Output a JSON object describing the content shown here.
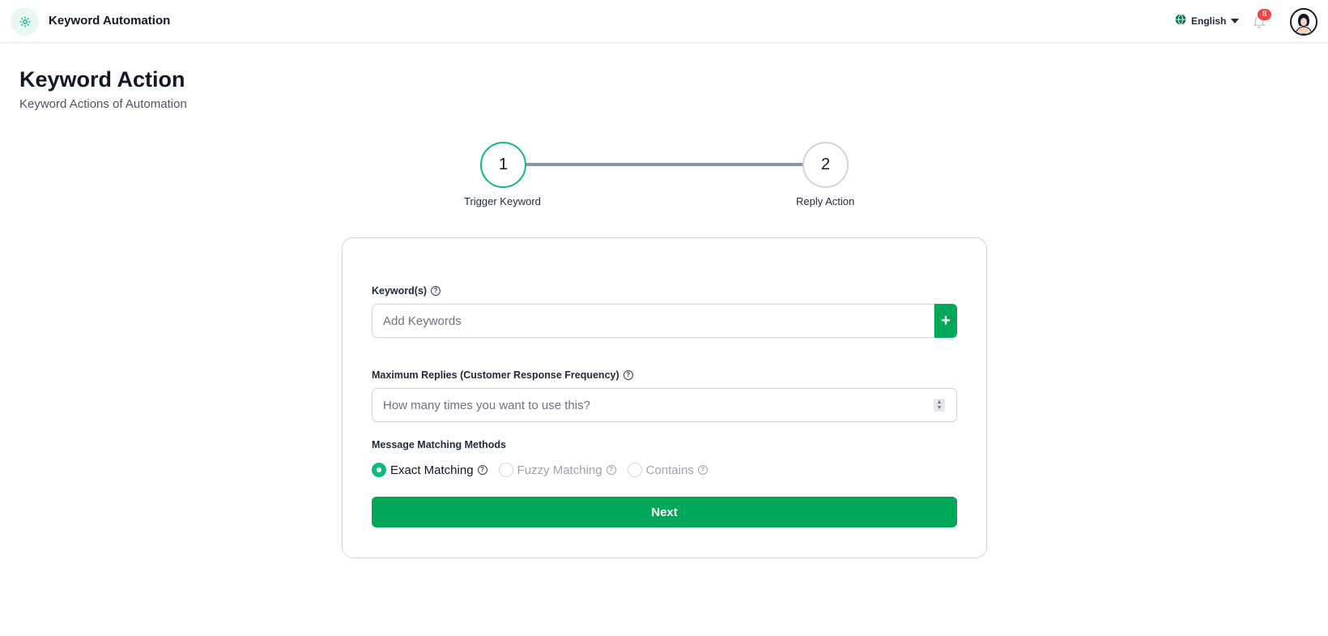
{
  "header": {
    "app_title": "Keyword Automation",
    "language": "English",
    "notification_count": "8",
    "brand_color": "#02a859"
  },
  "page": {
    "title": "Keyword Action",
    "subtitle": "Keyword Actions of Automation"
  },
  "stepper": {
    "steps": [
      {
        "number": "1",
        "label": "Trigger Keyword",
        "state": "active"
      },
      {
        "number": "2",
        "label": "Reply Action",
        "state": "inactive"
      }
    ]
  },
  "form": {
    "keywords": {
      "label": "Keyword(s)",
      "placeholder": "Add Keywords",
      "value": "",
      "add_button_label": "+"
    },
    "max_replies": {
      "label": "Maximum Replies (Customer Response Frequency)",
      "placeholder": "How many times you want to use this?",
      "value": ""
    },
    "matching": {
      "label": "Message Matching Methods",
      "selected": "Exact Matching",
      "options": [
        {
          "label": "Exact Matching",
          "checked": true
        },
        {
          "label": "Fuzzy Matching",
          "checked": false
        },
        {
          "label": "Contains",
          "checked": false
        }
      ]
    },
    "next_button_label": "Next"
  },
  "icons": {
    "logo": "gear-icon",
    "language": "globe-icon",
    "language_toggle": "caret-down-icon",
    "notifications": "bell-icon",
    "profile": "avatar",
    "help": "question-circle-icon"
  }
}
